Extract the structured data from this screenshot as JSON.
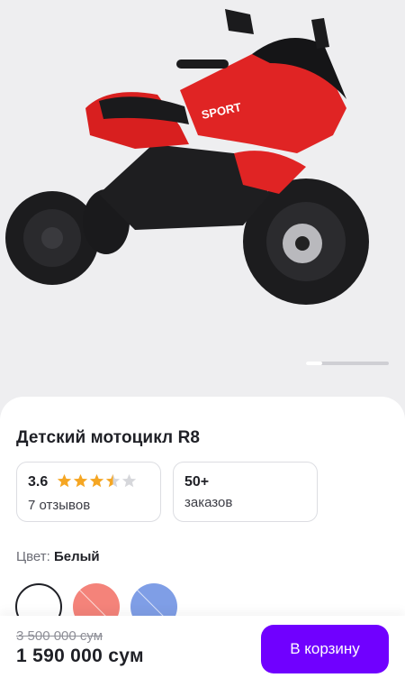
{
  "product": {
    "title": "Детский мотоцикл R8",
    "image_label": "SPORT",
    "rating": {
      "value": "3.6",
      "stars_filled": 3.5,
      "stars_total": 5,
      "reviews": "7 отзывов"
    },
    "orders": {
      "value": "50+",
      "label": "заказов"
    },
    "color": {
      "label": "Цвет:",
      "selected": "Белый",
      "options": [
        "white",
        "red",
        "blue"
      ]
    },
    "price": {
      "old": "3 500 000 сум",
      "current": "1 590 000 сум"
    },
    "cart_button": "В корзину"
  },
  "colors": {
    "accent": "#7000ff",
    "star": "#f5a623",
    "star_empty": "#d6d7db",
    "swatch_red": "#f4837a",
    "swatch_blue": "#7f9ee6"
  }
}
